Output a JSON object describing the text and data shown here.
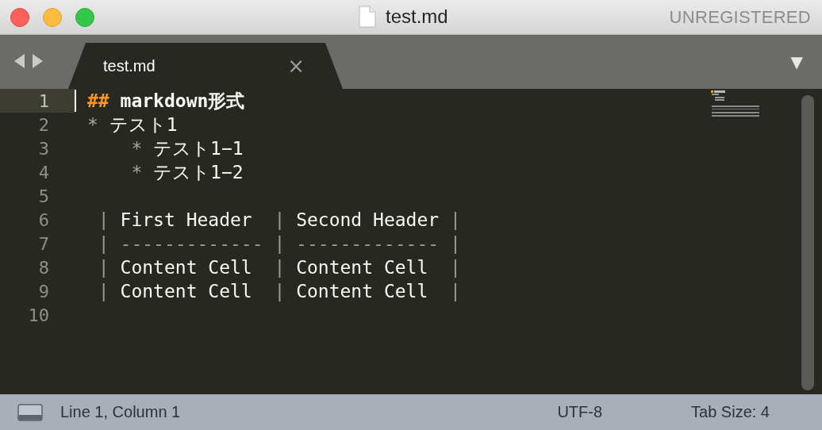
{
  "window": {
    "title": "test.md",
    "license": "UNREGISTERED"
  },
  "tabs": [
    {
      "label": "test.md",
      "close": "×",
      "selected": true
    }
  ],
  "tab_menu": "▼",
  "editor": {
    "lines": [
      {
        "number": "1",
        "current": true,
        "segments": [
          {
            "kind": "marker",
            "text": "##"
          },
          {
            "kind": "heading",
            "text": " markdown形式"
          }
        ]
      },
      {
        "number": "2",
        "current": false,
        "segments": [
          {
            "kind": "bullet",
            "text": "*"
          },
          {
            "kind": "text",
            "text": " テスト1"
          }
        ]
      },
      {
        "number": "3",
        "current": false,
        "segments": [
          {
            "kind": "bullet",
            "text": "    *"
          },
          {
            "kind": "text",
            "text": " テスト1−1"
          }
        ]
      },
      {
        "number": "4",
        "current": false,
        "segments": [
          {
            "kind": "bullet",
            "text": "    *"
          },
          {
            "kind": "text",
            "text": " テスト1−2"
          }
        ]
      },
      {
        "number": "5",
        "current": false
      },
      {
        "number": "6",
        "current": false,
        "segments": [
          {
            "kind": "pipe",
            "text": " |"
          },
          {
            "kind": "text",
            "text": " First Header  "
          },
          {
            "kind": "pipe",
            "text": "|"
          },
          {
            "kind": "text",
            "text": " Second Header "
          },
          {
            "kind": "pipe",
            "text": "|"
          }
        ]
      },
      {
        "number": "7",
        "current": false,
        "segments": [
          {
            "kind": "pipe",
            "text": " | ------------- | ------------- |"
          }
        ]
      },
      {
        "number": "8",
        "current": false,
        "segments": [
          {
            "kind": "pipe",
            "text": " |"
          },
          {
            "kind": "text",
            "text": " Content Cell  "
          },
          {
            "kind": "pipe",
            "text": "|"
          },
          {
            "kind": "text",
            "text": " Content Cell  "
          },
          {
            "kind": "pipe",
            "text": "|"
          }
        ]
      },
      {
        "number": "9",
        "current": false,
        "segments": [
          {
            "kind": "pipe",
            "text": " |"
          },
          {
            "kind": "text",
            "text": " Content Cell  "
          },
          {
            "kind": "pipe",
            "text": "|"
          },
          {
            "kind": "text",
            "text": " Content Cell  "
          },
          {
            "kind": "pipe",
            "text": "|"
          }
        ]
      },
      {
        "number": "10",
        "current": false
      }
    ]
  },
  "status_bar": {
    "position": "Line 1, Column 1",
    "encoding": "UTF-8",
    "tab_size": "Tab Size: 4"
  }
}
